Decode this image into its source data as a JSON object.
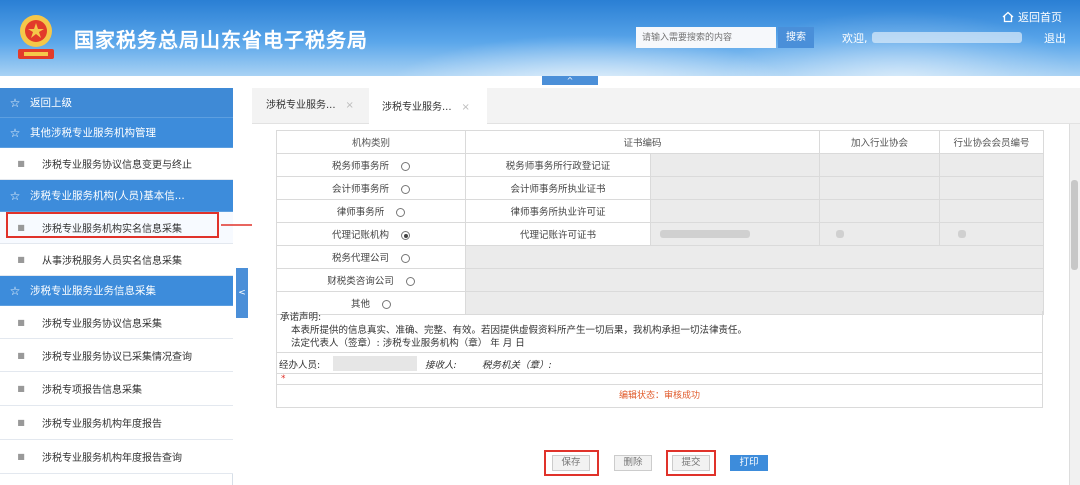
{
  "header": {
    "title": "国家税务总局山东省电子税务局",
    "home_label": "返回首页",
    "search_placeholder": "请输入需要搜索的内容",
    "search_button": "搜索",
    "welcome_label": "欢迎,",
    "logout_label": "退出",
    "collapse_top": "^"
  },
  "sidebar": {
    "items": [
      {
        "label": "返回上级",
        "type": "group"
      },
      {
        "label": "其他涉税专业服务机构管理",
        "type": "group"
      },
      {
        "label": "涉税专业服务协议信息变更与终止",
        "type": "item"
      },
      {
        "label": "涉税专业服务机构(人员)基本信...",
        "type": "group"
      },
      {
        "label": "涉税专业服务机构实名信息采集",
        "type": "item",
        "selected": true
      },
      {
        "label": "从事涉税服务人员实名信息采集",
        "type": "item"
      },
      {
        "label": "涉税专业服务业务信息采集",
        "type": "group"
      },
      {
        "label": "涉税专业服务协议信息采集",
        "type": "item"
      },
      {
        "label": "涉税专业服务协议已采集情况查询",
        "type": "item"
      },
      {
        "label": "涉税专项报告信息采集",
        "type": "item"
      },
      {
        "label": "涉税专业服务机构年度报告",
        "type": "item"
      },
      {
        "label": "涉税专业服务机构年度报告查询",
        "type": "item"
      }
    ],
    "collapse_label": "<"
  },
  "tabs": [
    {
      "label": "涉税专业服务...",
      "close": "×"
    },
    {
      "label": "涉税专业服务...",
      "close": "×",
      "active": true
    }
  ],
  "form": {
    "headers": {
      "org_type": "机构类别",
      "cert_no": "证书编码",
      "join_assoc": "加入行业协会",
      "member_no": "行业协会会员编号"
    },
    "rows": [
      {
        "type": "税务师事务所",
        "cert_label": "税务师事务所行政登记证",
        "checked": false
      },
      {
        "type": "会计师事务所",
        "cert_label": "会计师事务所执业证书",
        "checked": false
      },
      {
        "type": "律师事务所",
        "cert_label": "律师事务所执业许可证",
        "checked": false
      },
      {
        "type": "代理记账机构",
        "cert_label": "代理记账许可证书",
        "checked": true
      },
      {
        "type": "税务代理公司",
        "cert_label": "",
        "checked": false
      },
      {
        "type": "财税类咨询公司",
        "cert_label": "",
        "checked": false
      },
      {
        "type": "其他",
        "cert_label": "",
        "checked": false
      }
    ],
    "promise_title": "承诺声明:",
    "promise_text": "本表所提供的信息真实、准确、完整、有效。若因提供虚假资料所产生一切后果，我机构承担一切法律责任。",
    "promise_sign": "法定代表人（签章）:      涉税专业服务机构（章） 年 月 日",
    "handler_label": "经办人员:",
    "receiver_label": "接收人:",
    "tax_office_label": "税务机关（章）:",
    "required_mark": "*",
    "status_text": "编辑状态：审核成功"
  },
  "actions": {
    "save": "保存",
    "delete": "删除",
    "submit": "提交",
    "print": "打印"
  },
  "colors": {
    "header_blue": "#2a7fd4",
    "sidebar_group": "#3d8cdb",
    "highlight_red": "#e0322a",
    "status_orange": "#e05a2a"
  }
}
